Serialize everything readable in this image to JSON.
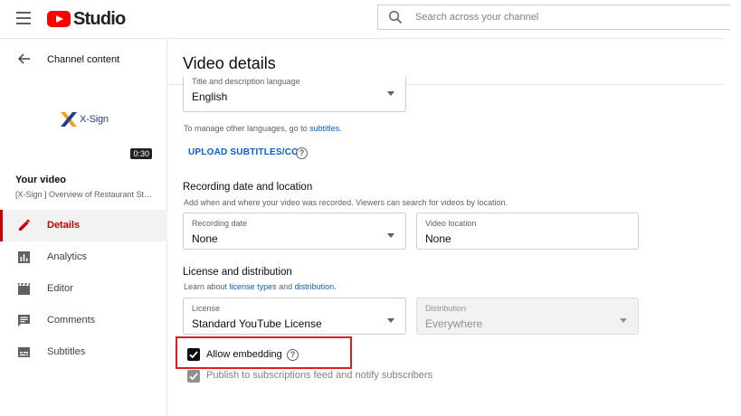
{
  "header": {
    "logo_text": "Studio",
    "search_placeholder": "Search across your channel",
    "brand_color": "#ff0000"
  },
  "sidebar": {
    "back_label": "Channel content",
    "thumbnail": {
      "brand_text": "X-Sign",
      "duration": "0:30"
    },
    "your_video_label": "Your video",
    "video_title": "[X-Sign ] Overview of Restaurant Sta...",
    "items": [
      {
        "label": "Details",
        "icon": "pencil-icon",
        "active": true
      },
      {
        "label": "Analytics",
        "icon": "analytics-icon",
        "active": false
      },
      {
        "label": "Editor",
        "icon": "clapperboard-icon",
        "active": false
      },
      {
        "label": "Comments",
        "icon": "comment-icon",
        "active": false
      },
      {
        "label": "Subtitles",
        "icon": "subtitles-icon",
        "active": false
      }
    ],
    "active_color": "#cc0000"
  },
  "main": {
    "title": "Video details",
    "language_field": {
      "label": "Title and description language",
      "value": "English"
    },
    "manage_languages": {
      "prefix": "To manage other languages, go to ",
      "link": "subtitles",
      "suffix": "."
    },
    "upload_button": "UPLOAD SUBTITLES/CC",
    "recording": {
      "title": "Recording date and location",
      "helper": "Add when and where your video was recorded. Viewers can search for videos by location.",
      "date_label": "Recording date",
      "date_value": "None",
      "location_label": "Video location",
      "location_value": "None"
    },
    "license": {
      "title": "License and distribution",
      "helper_prefix": "Learn about ",
      "helper_link1": "license types",
      "helper_mid": " and ",
      "helper_link2": "distribution",
      "helper_suffix": ".",
      "license_label": "License",
      "license_value": "Standard YouTube License",
      "distribution_label": "Distribution",
      "distribution_value": "Everywhere"
    },
    "allow_embedding": {
      "label": "Allow embedding",
      "checked": true
    },
    "publish_feed": {
      "label": "Publish to subscriptions feed and notify subscribers",
      "checked": true,
      "disabled": true
    },
    "link_color": "#065fd4",
    "highlight_color": "#d81f26"
  }
}
